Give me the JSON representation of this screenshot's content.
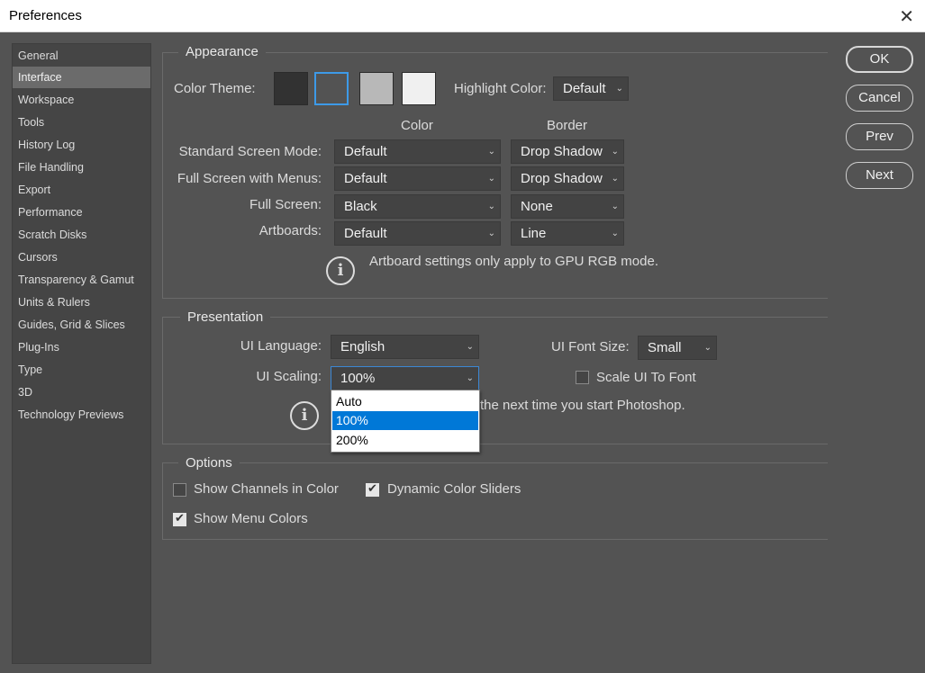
{
  "window": {
    "title": "Preferences",
    "close_glyph": "✕"
  },
  "sidebar": {
    "items": [
      {
        "label": "General",
        "active": false
      },
      {
        "label": "Interface",
        "active": true
      },
      {
        "label": "Workspace",
        "active": false
      },
      {
        "label": "Tools",
        "active": false
      },
      {
        "label": "History Log",
        "active": false
      },
      {
        "label": "File Handling",
        "active": false
      },
      {
        "label": "Export",
        "active": false
      },
      {
        "label": "Performance",
        "active": false
      },
      {
        "label": "Scratch Disks",
        "active": false
      },
      {
        "label": "Cursors",
        "active": false
      },
      {
        "label": "Transparency & Gamut",
        "active": false
      },
      {
        "label": "Units & Rulers",
        "active": false
      },
      {
        "label": "Guides, Grid & Slices",
        "active": false
      },
      {
        "label": "Plug-Ins",
        "active": false
      },
      {
        "label": "Type",
        "active": false
      },
      {
        "label": "3D",
        "active": false
      },
      {
        "label": "Technology Previews",
        "active": false
      }
    ]
  },
  "appearance": {
    "title": "Appearance",
    "color_theme_label": "Color Theme:",
    "theme_swatches": [
      "#323232",
      "#535353",
      "#b8b8b8",
      "#f0f0f0"
    ],
    "selected_theme_index": 1,
    "highlight_label": "Highlight Color:",
    "highlight_value": "Default",
    "col_color": "Color",
    "col_border": "Border",
    "rows": [
      {
        "label": "Standard Screen Mode:",
        "color": "Default",
        "border": "Drop Shadow"
      },
      {
        "label": "Full Screen with Menus:",
        "color": "Default",
        "border": "Drop Shadow"
      },
      {
        "label": "Full Screen:",
        "color": "Black",
        "border": "None"
      },
      {
        "label": "Artboards:",
        "color": "Default",
        "border": "Line"
      }
    ],
    "info_text": "Artboard settings only apply to GPU RGB mode."
  },
  "presentation": {
    "title": "Presentation",
    "ui_language_label": "UI Language:",
    "ui_language_value": "English",
    "ui_font_size_label": "UI Font Size:",
    "ui_font_size_value": "Small",
    "ui_scaling_label": "UI Scaling:",
    "ui_scaling_value": "100%",
    "scale_ui_label": "Scale UI To Font",
    "scale_ui_checked": false,
    "info_text_visible": "the next time you start Photoshop.",
    "scaling_options": [
      "Auto",
      "100%",
      "200%"
    ],
    "scaling_highlight_index": 1
  },
  "options": {
    "title": "Options",
    "show_channels_label": "Show Channels in Color",
    "show_channels_checked": false,
    "dynamic_sliders_label": "Dynamic Color Sliders",
    "dynamic_sliders_checked": true,
    "show_menu_colors_label": "Show Menu Colors",
    "show_menu_colors_checked": true
  },
  "buttons": {
    "ok": "OK",
    "cancel": "Cancel",
    "prev": "Prev",
    "next": "Next"
  },
  "icons": {
    "info": "info-icon",
    "chevron": "chevron-down-icon",
    "check": "checkmark-icon"
  },
  "colors": {
    "accent": "#3d9ae8",
    "highlight": "#0078d7",
    "panel": "#535353"
  }
}
